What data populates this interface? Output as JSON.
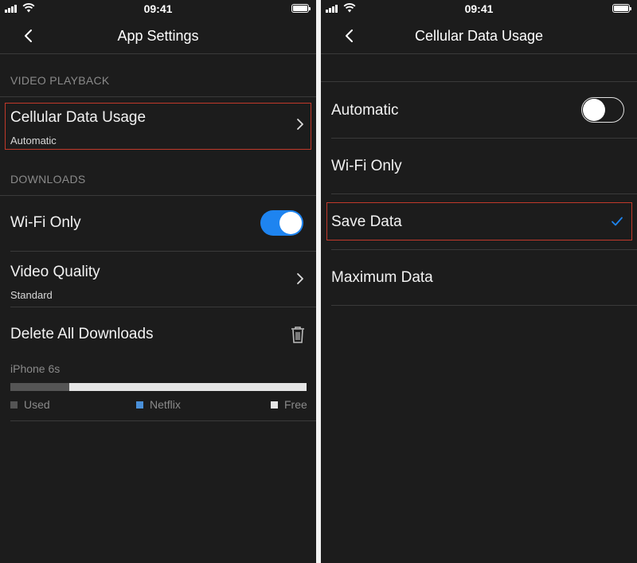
{
  "status": {
    "time": "09:41"
  },
  "left": {
    "nav_title": "App Settings",
    "section_video": "VIDEO PLAYBACK",
    "cellular_title": "Cellular Data Usage",
    "cellular_value": "Automatic",
    "section_downloads": "DOWNLOADS",
    "wifi_only_label": "Wi-Fi Only",
    "wifi_only_on": true,
    "video_quality_title": "Video Quality",
    "video_quality_value": "Standard",
    "delete_all_label": "Delete All Downloads",
    "device_name": "iPhone 6s",
    "storage": {
      "used_fraction": 0.2,
      "netflix_fraction": 0.0
    },
    "legend": {
      "used": "Used",
      "netflix": "Netflix",
      "free": "Free"
    }
  },
  "right": {
    "nav_title": "Cellular Data Usage",
    "options": [
      {
        "label": "Automatic"
      },
      {
        "label": "Wi-Fi Only"
      },
      {
        "label": "Save Data"
      },
      {
        "label": "Maximum Data"
      }
    ],
    "automatic_on": false,
    "selected_option": "Save Data"
  },
  "colors": {
    "accent": "#1e84f0",
    "highlight": "#c1392b",
    "background": "#1c1c1c",
    "netflix_legend": "#4a90d9"
  },
  "icons": [
    "back-chevron-icon",
    "chevron-right-icon",
    "trash-icon",
    "checkmark-icon",
    "signal-icon",
    "wifi-icon",
    "battery-icon"
  ]
}
